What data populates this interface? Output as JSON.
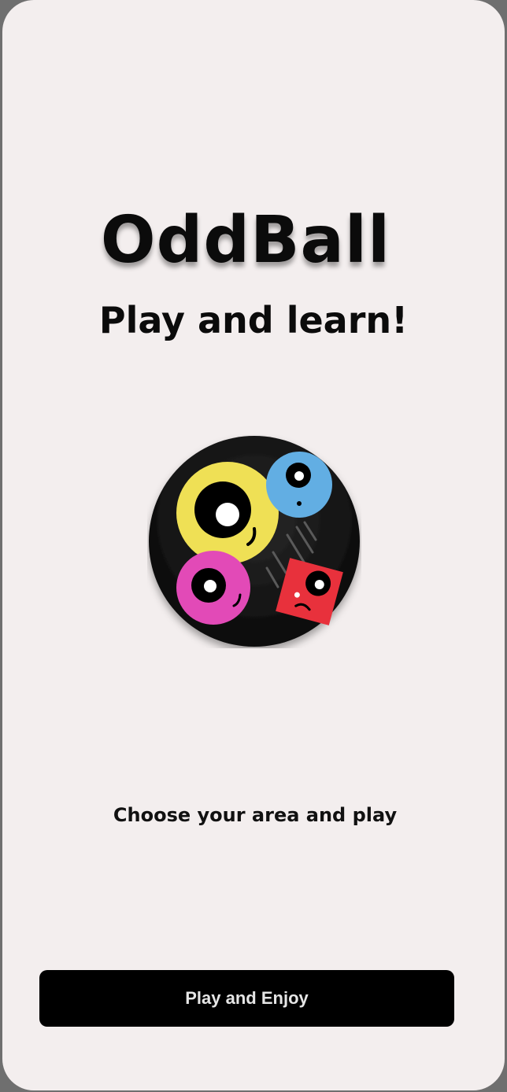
{
  "app": {
    "title": "OddBall",
    "tagline": "Play and learn!",
    "instruction": "Choose your area and play",
    "primary_button_label": "Play and Enjoy"
  },
  "logo": {
    "icon": "oddball-logo-icon",
    "colors": {
      "background": "#121212",
      "yellow_ball": "#efe055",
      "blue_ball": "#62aee3",
      "pink_ball": "#e24ab7",
      "red_square": "#e8313c"
    }
  },
  "colors": {
    "page_background": "#f3eeee",
    "button_background": "#000000",
    "button_text": "#e6e6e6"
  }
}
